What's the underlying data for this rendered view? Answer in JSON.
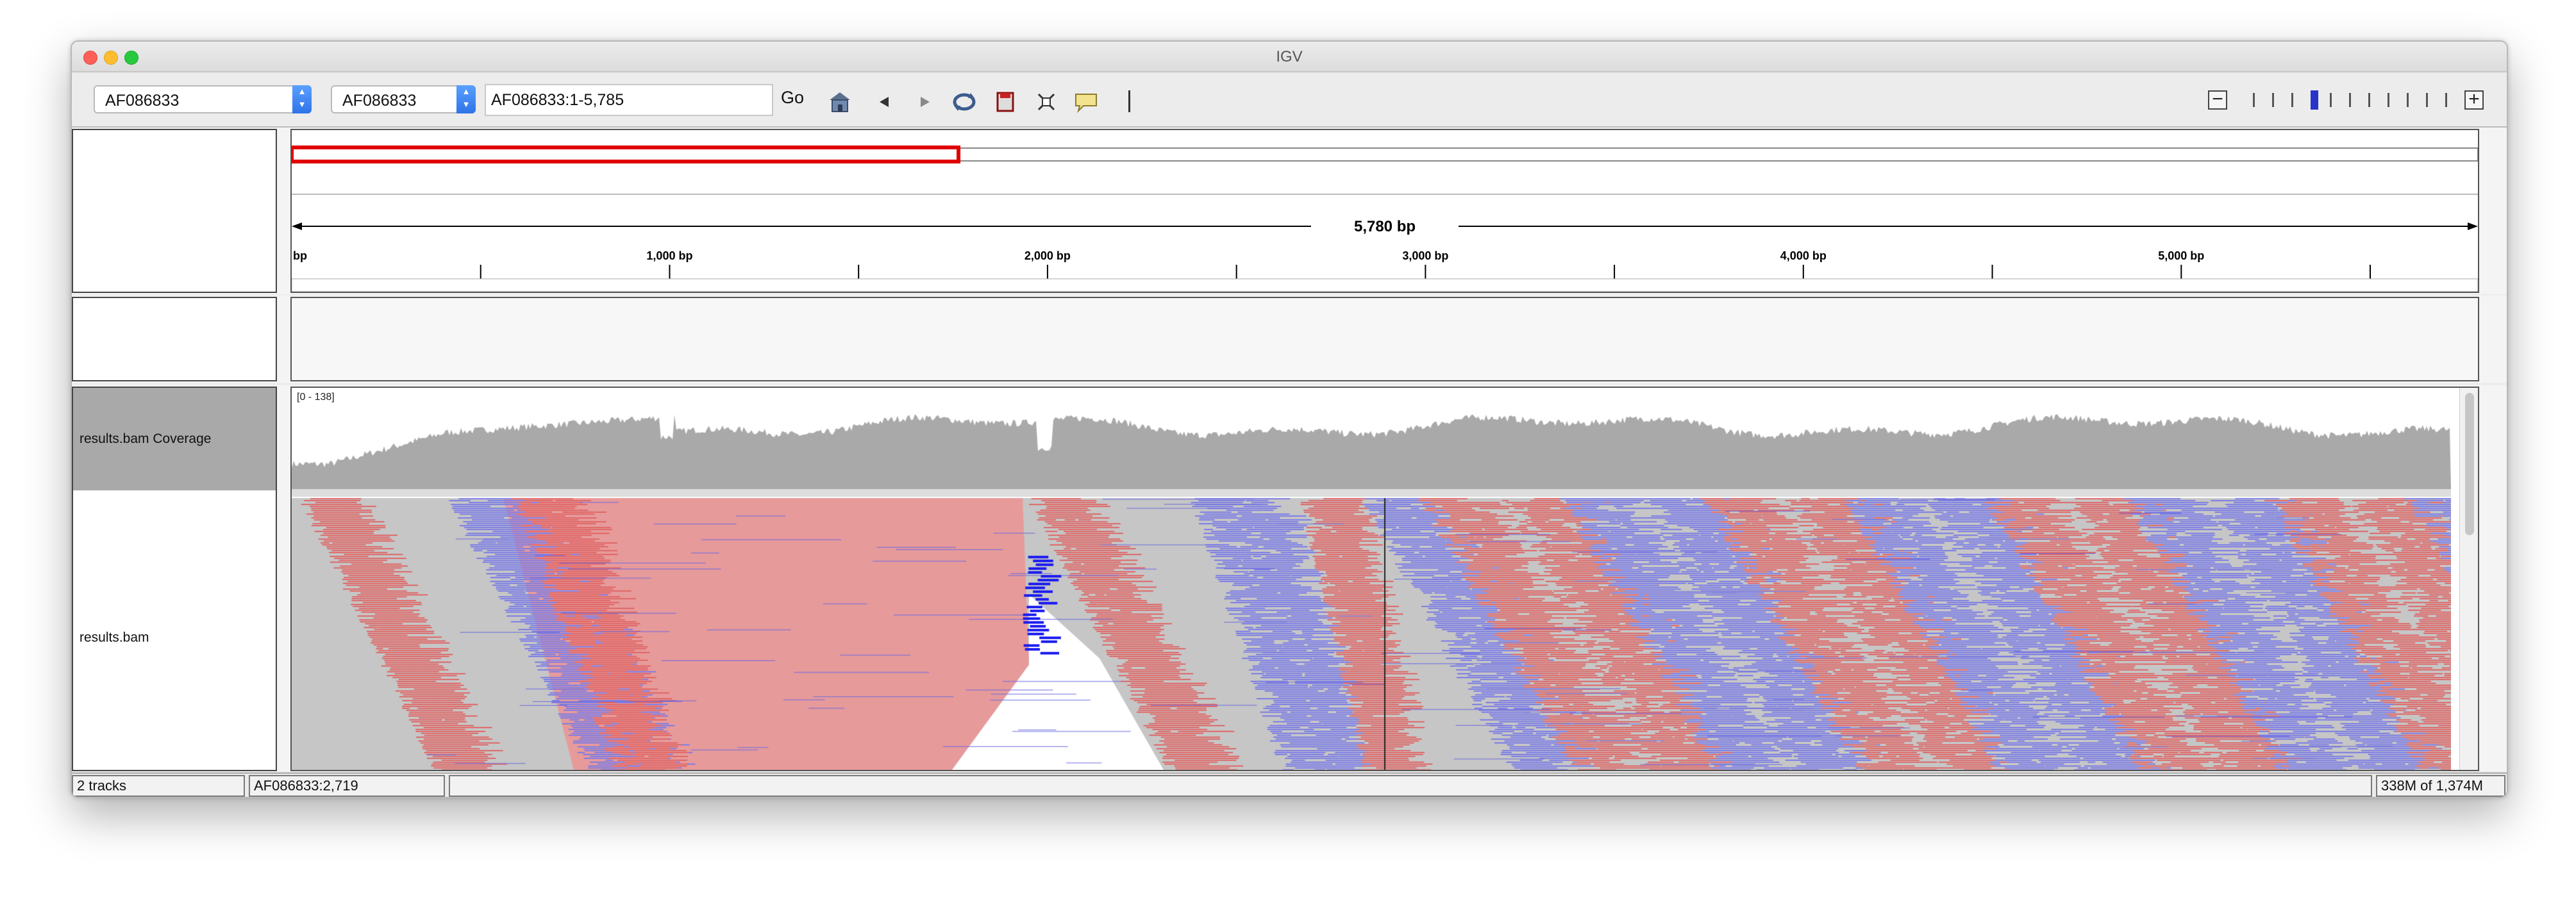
{
  "window": {
    "title": "IGV"
  },
  "toolbar": {
    "genome": "AF086833",
    "chromosome": "AF086833",
    "locus": "AF086833:1-5,785",
    "go_label": "Go",
    "zoom_level": 3,
    "zoom_ticks": 11,
    "icons": [
      "home-icon",
      "back-icon",
      "forward-icon",
      "refresh-icon",
      "region-of-interest-icon",
      "resize-icon",
      "popup-text-icon"
    ]
  },
  "ruler": {
    "length_label": "5,780 bp",
    "start_label": "bp",
    "ticks": [
      "1,000 bp",
      "2,000 bp",
      "3,000 bp",
      "4,000 bp",
      "5,000 bp"
    ],
    "tick_values": [
      1000,
      2000,
      3000,
      4000,
      5000
    ],
    "genome_length": 5785,
    "view_fraction": 0.305
  },
  "tracks": [
    {
      "name": "results.bam Coverage",
      "range": "[0 - 138]"
    },
    {
      "name": "results.bam"
    }
  ],
  "status": {
    "tracks": "2 tracks",
    "position": "AF086833:2,719",
    "memory": "338M of 1,374M"
  },
  "colors": {
    "coverage": "#a9a9a9",
    "read": "#c6c6c6",
    "insert_large": "#e79a9a",
    "insert_small": "#7b7ce6",
    "roi": "#e00000"
  }
}
